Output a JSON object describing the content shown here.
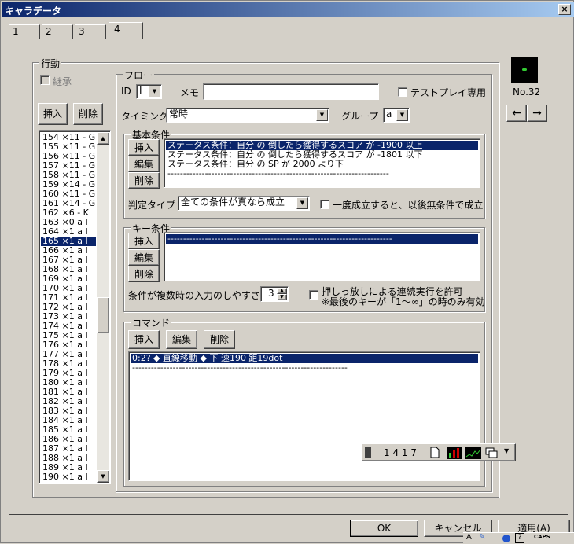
{
  "window": {
    "title": "キャラデータ",
    "close": "×"
  },
  "tabs": [
    "1",
    "2",
    "3",
    "4"
  ],
  "behavior": {
    "group_label": "行動",
    "inherit_label": "継承",
    "insert": "挿入",
    "delete": "削除",
    "items": [
      "154 ×11 - G",
      "155 ×11 - G",
      "156 ×11 - G",
      "157 ×11 - G",
      "158 ×11 - G",
      "159 ×14 - G",
      "160 ×11 - G",
      "161 ×14 - G",
      "162 ×6 - K",
      "163 ×0 a I",
      "164 ×1 a I",
      "165 ×1 a I",
      "166 ×1 a I",
      "167 ×1 a I",
      "168 ×1 a I",
      "169 ×1 a I",
      "170 ×1 a I",
      "171 ×1 a I",
      "172 ×1 a I",
      "173 ×1 a I",
      "174 ×1 a I",
      "175 ×1 a I",
      "176 ×1 a I",
      "177 ×1 a I",
      "178 ×1 a I",
      "179 ×1 a I",
      "180 ×1 a I",
      "181 ×1 a I",
      "182 ×1 a I",
      "183 ×1 a I",
      "184 ×1 a I",
      "185 ×1 a I",
      "186 ×1 a I",
      "187 ×1 a I",
      "188 ×1 a I",
      "189 ×1 a I",
      "190 ×1 a I"
    ],
    "selected_index": 11
  },
  "flow": {
    "group_label": "フロー",
    "id_label": "ID",
    "id_value": "I",
    "memo_label": "メモ",
    "memo_value": "",
    "testplay_label": "テストプレイ専用",
    "timing_label": "タイミング",
    "timing_value": "常時",
    "group_sel_label": "グループ",
    "group_value": "a"
  },
  "basic": {
    "group_label": "基本条件",
    "insert": "挿入",
    "edit": "編集",
    "delete": "削除",
    "entries": [
      "ステータス条件：自分 の 倒したら獲得するスコア が -1900 以上",
      "ステータス条件：自分 の 倒したら獲得するスコア が -1801 以下",
      "ステータス条件：自分 の SP が 2000 より下",
      "-----------------------------------------------------------------------"
    ],
    "judge_label": "判定タイプ",
    "judge_value": "全ての条件が真なら成立",
    "once_label": "一度成立すると、以後無条件で成立"
  },
  "key": {
    "group_label": "キー条件",
    "insert": "挿入",
    "edit": "編集",
    "delete": "削除",
    "entries": [
      "------------------------------------------------------------------------"
    ],
    "ease_label": "条件が複数時の入力のしやすさ",
    "ease_value": "3",
    "hold_label": "押しっ放しによる連続実行を許可",
    "hold_note": "※最後のキーが「1～∞」の時のみ有効"
  },
  "command": {
    "group_label": "コマンド",
    "insert": "挿入",
    "edit": "編集",
    "delete": "削除",
    "entries": [
      "0:2? ◆ 直線移動 ◆ 下 速190 距19dot",
      "---------------------------------------------------------------------"
    ]
  },
  "preview": {
    "number": "No.32",
    "left": "←",
    "right": "→"
  },
  "taskbar": {
    "count": "1 4 1 7"
  },
  "footer": {
    "ok": "OK",
    "cancel": "キャンセル",
    "apply": "適用(A)",
    "caps": "CAPS"
  }
}
